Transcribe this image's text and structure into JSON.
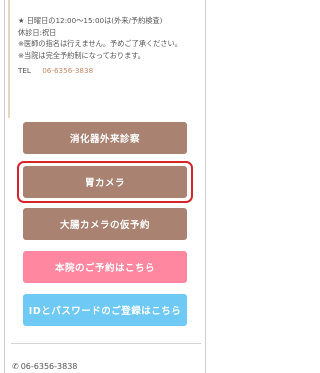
{
  "info": {
    "hours": "★ 日曜日の12:00～15:00は(外来/予約検査)",
    "closed": "休診日:祝日",
    "doctor_note": "※医師の指名は行えません。予めご了承ください。",
    "reservation_note": "※当院は完全予約制になっております。",
    "tel_label": "TEL",
    "tel_number": "06-6356-3838"
  },
  "buttons": {
    "outpatient": "消化器外来診察",
    "gastroscopy": "胃カメラ",
    "colonoscopy": "大腸カメラの仮予約",
    "main_clinic": "本院のご予約はこちら",
    "id_registration": "IDとパスワードのご登録はこちら"
  },
  "footer": {
    "phone_icon": "phone-icon",
    "tel": "06-6356-3838"
  },
  "colors": {
    "button_brown": "#a98272",
    "button_pink": "#ff88a0",
    "button_blue": "#6ec9f4",
    "highlight_red": "#d3252b",
    "tel_accent": "#c5896a"
  }
}
